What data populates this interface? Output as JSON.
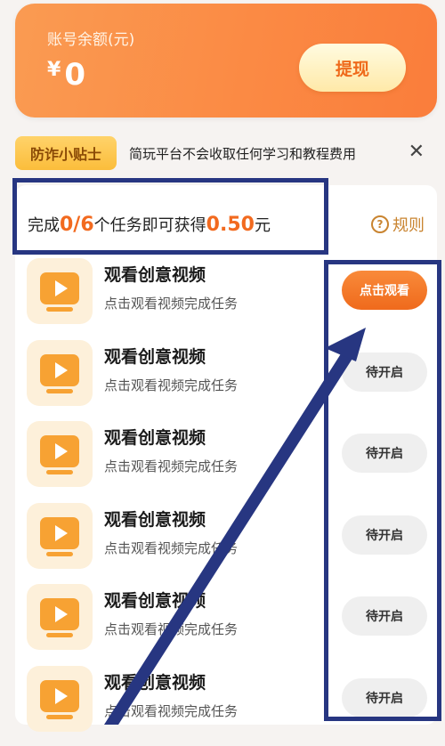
{
  "balance": {
    "label": "账号余额(元)",
    "currency": "¥",
    "amount": "0",
    "withdraw_label": "提现"
  },
  "tip": {
    "badge": "防诈小贴士",
    "text": "简玩平台不会收取任何学习和教程费用",
    "close": "✕"
  },
  "progress": {
    "prefix": "完成",
    "count": "0/6",
    "middle": "个任务即可获得",
    "reward": "0.50",
    "suffix": "元",
    "rules_label": "规则",
    "rules_icon": "?"
  },
  "tasks": [
    {
      "title": "观看创意视频",
      "desc": "点击观看视频完成任务",
      "button": "点击观看",
      "state": "active"
    },
    {
      "title": "观看创意视频",
      "desc": "点击观看视频完成任务",
      "button": "待开启",
      "state": "idle"
    },
    {
      "title": "观看创意视频",
      "desc": "点击观看视频完成任务",
      "button": "待开启",
      "state": "idle"
    },
    {
      "title": "观看创意视频",
      "desc": "点击观看视频完成任务",
      "button": "待开启",
      "state": "idle"
    },
    {
      "title": "观看创意视频",
      "desc": "点击观看视频完成任务",
      "button": "待开启",
      "state": "idle"
    },
    {
      "title": "观看创意视频",
      "desc": "点击观看视频完成任务",
      "button": "待开启",
      "state": "idle"
    }
  ],
  "colors": {
    "accent": "#f26a1f",
    "annotation": "#273681",
    "icon_orange": "#f7a233"
  },
  "icons": {
    "task": "video-play-icon",
    "close": "close-icon",
    "rules": "question-circle-icon"
  }
}
